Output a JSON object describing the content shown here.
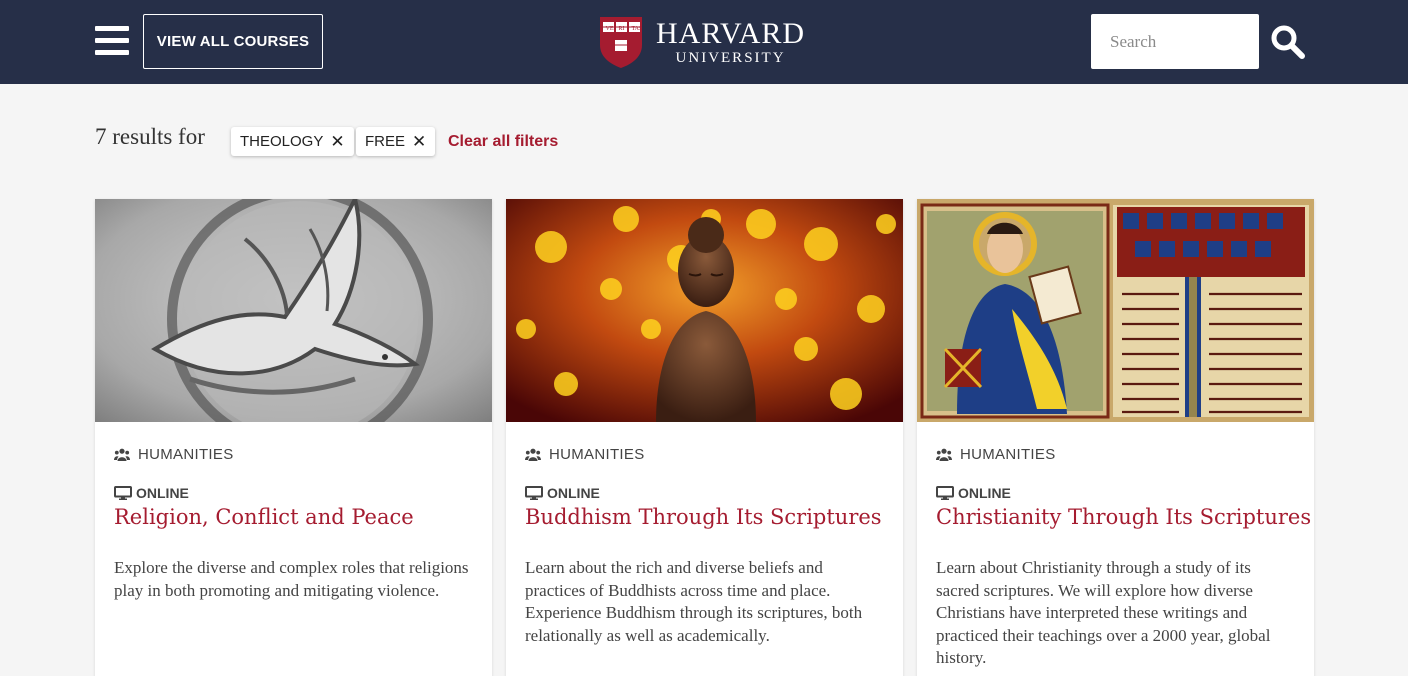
{
  "header": {
    "menu_icon": "hamburger-menu-icon",
    "view_all_label": "VIEW ALL COURSES",
    "logo_line1": "HARVARD",
    "logo_line2": "UNIVERSITY",
    "search_placeholder": "Search",
    "search_icon": "search-icon",
    "background_color": "#262f48"
  },
  "filters": {
    "results_text": "7 results for",
    "chips": [
      {
        "label": "THEOLOGY",
        "remove_icon": "close-icon"
      },
      {
        "label": "FREE",
        "remove_icon": "close-icon"
      }
    ],
    "clear_label": "Clear all filters"
  },
  "accent_color": "#a51c30",
  "courses": [
    {
      "subject": "HUMANITIES",
      "subject_icon": "users-icon",
      "format": "ONLINE",
      "format_icon": "monitor-icon",
      "title": "Religion, Conflict and Peace",
      "description": "Explore the diverse and complex roles that religions play in both promoting and mitigating violence.",
      "image": "carved-stone-dove"
    },
    {
      "subject": "HUMANITIES",
      "subject_icon": "users-icon",
      "format": "ONLINE",
      "format_icon": "monitor-icon",
      "title": "Buddhism Through Its Scriptures",
      "description": "Learn about the rich and diverse beliefs and practices of Buddhists across time and place. Experience Buddhism through its scriptures, both relationally as well as academically.",
      "image": "buddha-statue-bokeh"
    },
    {
      "subject": "HUMANITIES",
      "subject_icon": "users-icon",
      "format": "ONLINE",
      "format_icon": "monitor-icon",
      "title": "Christianity Through Its Scriptures",
      "description": "Learn about Christianity through a study of its sacred scriptures. We will explore how diverse Christians have interpreted these writings and practiced their teachings over a 2000 year, global history.",
      "image": "illuminated-manuscript"
    }
  ]
}
